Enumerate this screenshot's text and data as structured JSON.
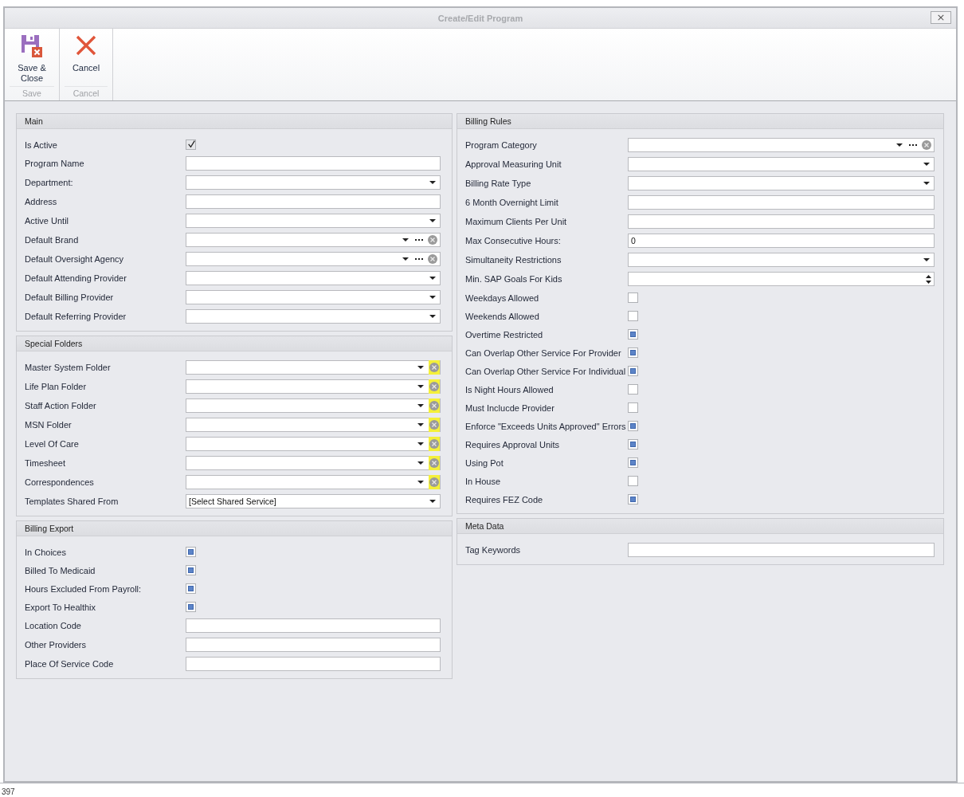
{
  "window": {
    "title": "Create/Edit Program",
    "close_symbol": "×"
  },
  "ribbon": {
    "groups": [
      {
        "caption": "Save",
        "buttons": [
          {
            "label": "Save & Close"
          }
        ]
      },
      {
        "caption": "Cancel",
        "buttons": [
          {
            "label": "Cancel"
          }
        ]
      }
    ]
  },
  "columns": [
    {
      "groups": [
        {
          "title": "Main",
          "fields": [
            {
              "label": "Is Active",
              "kind": "checkbox",
              "checked": true
            },
            {
              "label": "Program Name",
              "kind": "text"
            },
            {
              "label": "Department:",
              "kind": "dropdown"
            },
            {
              "label": "Address",
              "kind": "text"
            },
            {
              "label": "Active Until",
              "kind": "dropdown"
            },
            {
              "label": "Default Brand",
              "kind": "lookup"
            },
            {
              "label": "Default Oversight Agency",
              "kind": "lookup"
            },
            {
              "label": "Default Attending Provider",
              "kind": "dropdown"
            },
            {
              "label": "Default Billing Provider",
              "kind": "dropdown"
            },
            {
              "label": "Default Referring Provider",
              "kind": "dropdown"
            }
          ]
        },
        {
          "title": "Special Folders",
          "fields": [
            {
              "label": "Master System Folder",
              "kind": "clearable",
              "highlighted": true
            },
            {
              "label": "Life Plan Folder",
              "kind": "clearable",
              "highlighted": true
            },
            {
              "label": "Staff Action Folder",
              "kind": "clearable",
              "highlighted": true
            },
            {
              "label": "MSN Folder",
              "kind": "clearable",
              "highlighted": true
            },
            {
              "label": "Level Of Care",
              "kind": "clearable",
              "highlighted": true
            },
            {
              "label": "Timesheet",
              "kind": "clearable",
              "highlighted": true
            },
            {
              "label": "Correspondences",
              "kind": "clearable",
              "highlighted": true
            },
            {
              "label": "Templates Shared From",
              "kind": "dropdown",
              "value": "[Select Shared Service]"
            }
          ]
        },
        {
          "title": "Billing Export",
          "fields": [
            {
              "label": "In Choices",
              "kind": "checkbox",
              "checked": false,
              "indeterminate": true
            },
            {
              "label": "Billed To Medicaid",
              "kind": "checkbox",
              "checked": false,
              "indeterminate": true
            },
            {
              "label": "Hours Excluded From Payroll:",
              "kind": "checkbox",
              "checked": false,
              "indeterminate": true
            },
            {
              "label": "Export To Healthix",
              "kind": "checkbox",
              "checked": false,
              "indeterminate": true
            },
            {
              "label": "Location Code",
              "kind": "text"
            },
            {
              "label": "Other Providers",
              "kind": "text"
            },
            {
              "label": "Place Of Service Code",
              "kind": "text"
            }
          ]
        }
      ]
    },
    {
      "groups": [
        {
          "title": "Billing Rules",
          "fields": [
            {
              "label": "Program Category",
              "kind": "lookup"
            },
            {
              "label": "Approval Measuring Unit",
              "kind": "dropdown"
            },
            {
              "label": "Billing Rate Type",
              "kind": "dropdown"
            },
            {
              "label": "6 Month Overnight Limit",
              "kind": "text"
            },
            {
              "label": "Maximum Clients Per Unit",
              "kind": "text"
            },
            {
              "label": "Max Consecutive Hours:",
              "kind": "text",
              "value": "0"
            },
            {
              "label": "Simultaneity Restrictions",
              "kind": "dropdown"
            },
            {
              "label": "Min. SAP Goals For Kids",
              "kind": "spin"
            },
            {
              "label": "Weekdays Allowed",
              "kind": "checkbox",
              "checked": false,
              "indeterminate": false
            },
            {
              "label": "Weekends Allowed",
              "kind": "checkbox",
              "checked": false,
              "indeterminate": false
            },
            {
              "label": "Overtime Restricted",
              "kind": "checkbox",
              "checked": false,
              "indeterminate": true
            },
            {
              "label": "Can Overlap Other Service For Provider",
              "kind": "checkbox",
              "checked": false,
              "indeterminate": true
            },
            {
              "label": "Can Overlap Other Service For Individual",
              "kind": "checkbox",
              "checked": false,
              "indeterminate": true
            },
            {
              "label": "Is Night Hours Allowed",
              "kind": "checkbox",
              "checked": false,
              "indeterminate": false
            },
            {
              "label": "Must Inclucde Provider",
              "kind": "checkbox",
              "checked": false,
              "indeterminate": false
            },
            {
              "label": "Enforce \"Exceeds Units Approved\" Errors",
              "kind": "checkbox",
              "checked": false,
              "indeterminate": true
            },
            {
              "label": "Requires Approval Units",
              "kind": "checkbox",
              "checked": false,
              "indeterminate": true
            },
            {
              "label": "Using Pot",
              "kind": "checkbox",
              "checked": false,
              "indeterminate": true
            },
            {
              "label": "In House",
              "kind": "checkbox",
              "checked": false,
              "indeterminate": false
            },
            {
              "label": "Requires FEZ Code",
              "kind": "checkbox",
              "checked": false,
              "indeterminate": true
            }
          ]
        },
        {
          "title": "Meta Data",
          "fields": [
            {
              "label": "Tag Keywords",
              "kind": "text"
            }
          ]
        }
      ]
    }
  ],
  "background_text": "397"
}
